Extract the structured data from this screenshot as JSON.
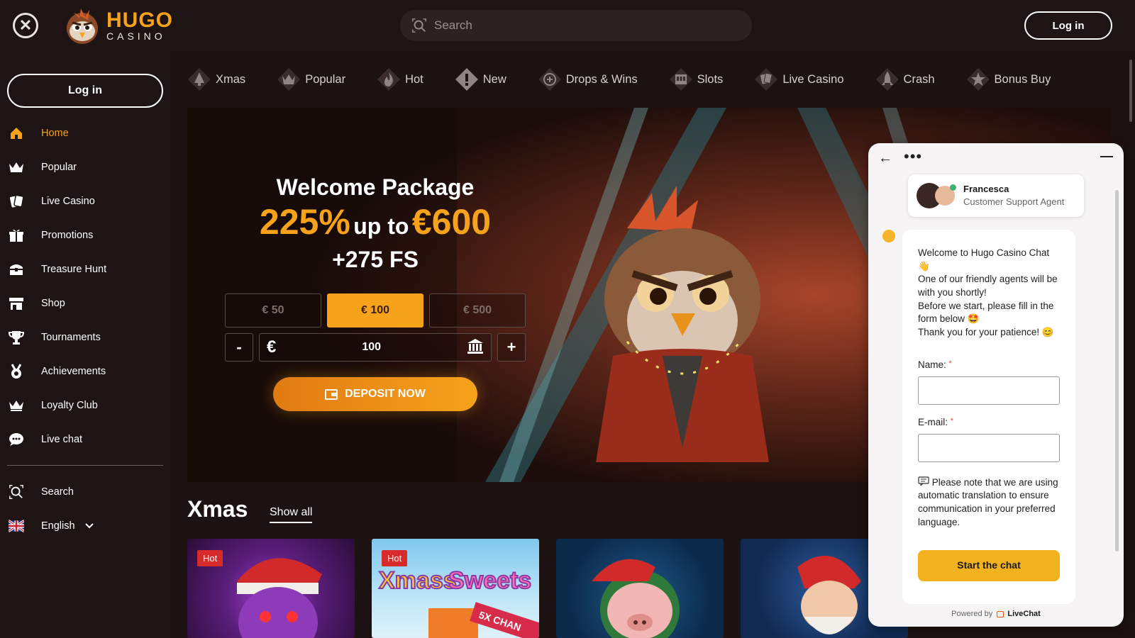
{
  "header": {
    "logo_main": "HUGO",
    "logo_sub": "CASINO",
    "search_placeholder": "Search",
    "login_label": "Log in"
  },
  "sidebar": {
    "login_label": "Log in",
    "items": [
      {
        "label": "Home",
        "icon": "home-icon"
      },
      {
        "label": "Popular",
        "icon": "crown-icon"
      },
      {
        "label": "Live Casino",
        "icon": "cards-icon"
      },
      {
        "label": "Promotions",
        "icon": "gift-icon"
      },
      {
        "label": "Treasure Hunt",
        "icon": "treasure-chest-icon"
      },
      {
        "label": "Shop",
        "icon": "shop-icon"
      },
      {
        "label": "Tournaments",
        "icon": "trophy-icon"
      },
      {
        "label": "Achievements",
        "icon": "medal-icon"
      },
      {
        "label": "Loyalty Club",
        "icon": "crown-icon"
      },
      {
        "label": "Live chat",
        "icon": "chat-icon"
      }
    ],
    "search_label": "Search",
    "language_label": "English"
  },
  "tabs": [
    {
      "label": "Xmas"
    },
    {
      "label": "Popular"
    },
    {
      "label": "Hot"
    },
    {
      "label": "New"
    },
    {
      "label": "Drops & Wins"
    },
    {
      "label": "Slots"
    },
    {
      "label": "Live Casino"
    },
    {
      "label": "Crash"
    },
    {
      "label": "Bonus Buy"
    }
  ],
  "promo": {
    "title": "Welcome Package",
    "percent": "225%",
    "up_to": "up to",
    "amount": "€600",
    "fs": "+275 FS",
    "amounts": [
      "€ 50",
      "€ 100",
      "€ 500"
    ],
    "selected_amount": "€ 100",
    "minus": "-",
    "plus": "+",
    "currency_symbol": "€",
    "deposit_value": "100",
    "deposit_label": "DEPOSIT NOW"
  },
  "section": {
    "title": "Xmas",
    "show_all": "Show all",
    "badge": "Hot"
  },
  "chat": {
    "agent_name": "Francesca",
    "agent_role": "Customer Support Agent",
    "welcome": "Welcome to Hugo Casino Chat 👋",
    "line2": "One of our friendly agents will be with you shortly!",
    "line3": "Before we start, please fill in the form below 🤩",
    "line4": "Thank you for your patience! 😊",
    "name_label": "Name:",
    "email_label": "E-mail:",
    "required_mark": "*",
    "note": "Please note that we are using automatic translation to ensure communication in your preferred language.",
    "start_label": "Start the chat",
    "powered_by": "Powered by",
    "powered_brand": "LiveChat"
  },
  "colors": {
    "accent": "#f7a21b",
    "background": "#1d1212",
    "badge": "#d72b2b"
  }
}
